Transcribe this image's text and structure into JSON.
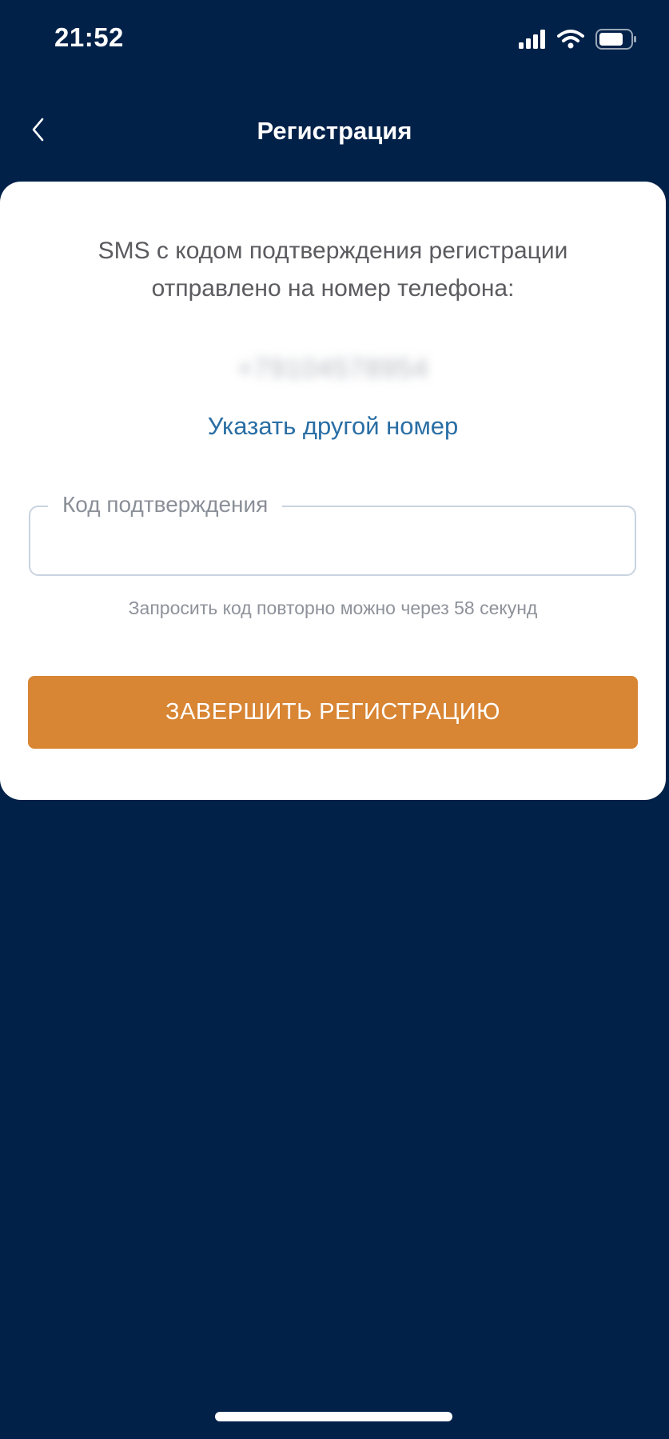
{
  "status_bar": {
    "time": "21:52",
    "icons": [
      "signal-icon",
      "wifi-icon",
      "battery-icon"
    ]
  },
  "nav": {
    "title": "Регистрация",
    "back_icon": "chevron-left-icon"
  },
  "card": {
    "sms_message": "SMS с кодом подтверждения регистрации отправлено на номер телефона:",
    "phone_number": "+79104578954",
    "change_number_link": "Указать другой номер",
    "code_field": {
      "label": "Код подтверждения",
      "value": ""
    },
    "resend_hint": "Запросить код повторно можно через 58 секунд",
    "finish_button": "ЗАВЕРШИТЬ РЕГИСТРАЦИЮ"
  },
  "colors": {
    "background": "#012149",
    "accent_button": "#d88534",
    "link": "#2a6ea4"
  }
}
